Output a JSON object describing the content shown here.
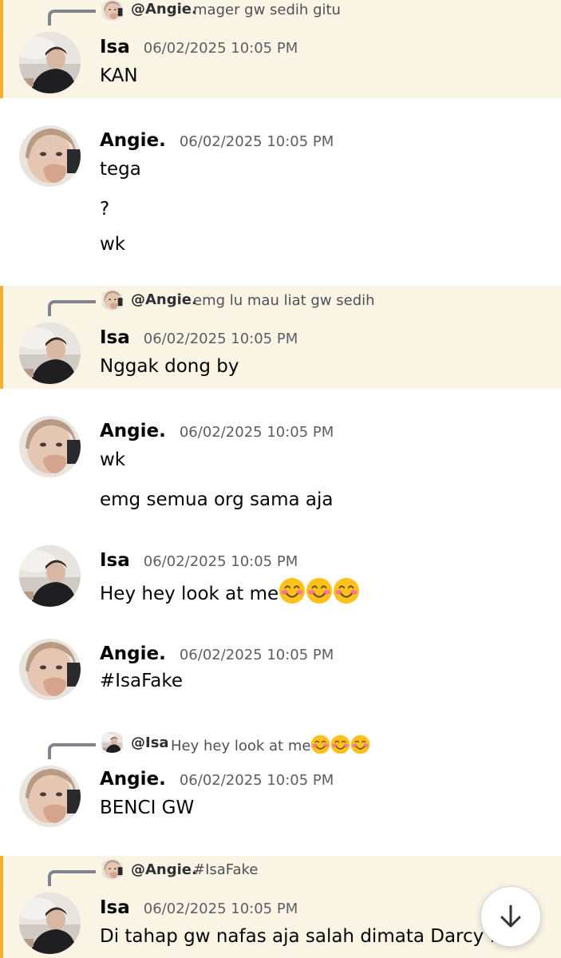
{
  "messages": [
    {
      "reply": {
        "name": "@Angie.",
        "text": "mager gw sedih gitu"
      },
      "author": "Isa",
      "time": "06/02/2025 10:05 PM",
      "lines": [
        "KAN"
      ]
    },
    {
      "author": "Angie.",
      "time": "06/02/2025 10:05 PM",
      "lines": [
        "tega",
        "?",
        "wk"
      ]
    },
    {
      "reply": {
        "name": "@Angie.",
        "text": "emg lu mau liat gw sedih"
      },
      "author": "Isa",
      "time": "06/02/2025 10:05 PM",
      "lines": [
        "Nggak dong by"
      ]
    },
    {
      "author": "Angie.",
      "time": "06/02/2025 10:05 PM",
      "lines": [
        "wk",
        "emg semua org sama aja"
      ]
    },
    {
      "author": "Isa",
      "time": "06/02/2025 10:05 PM",
      "lines": [
        "Hey hey look at me"
      ]
    },
    {
      "author": "Angie.",
      "time": "06/02/2025 10:05 PM",
      "lines": [
        "#IsaFake"
      ]
    },
    {
      "reply": {
        "name": "@Isa",
        "text": "Hey hey look at me"
      },
      "author": "Angie.",
      "time": "06/02/2025 10:05 PM",
      "lines": [
        "BENCI GW"
      ]
    },
    {
      "reply": {
        "name": "@Angie.",
        "text": "#IsaFake"
      },
      "author": "Isa",
      "time": "06/02/2025 10:05 PM",
      "lines": [
        "Di tahap gw nafas aja salah dimata Darcy fa"
      ]
    }
  ],
  "icons": {
    "emoji": "smiling-face-with-smiling-eyes",
    "scroll": "arrow-down-icon"
  },
  "colors": {
    "highlight_bg": "#faf4e4",
    "highlight_bar": "#f0b232",
    "timestamp": "#5c5e66"
  }
}
